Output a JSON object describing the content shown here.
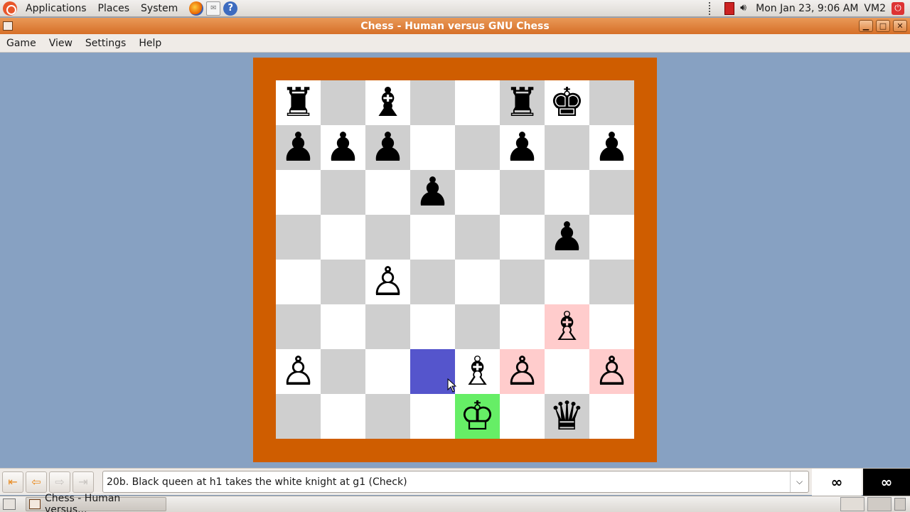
{
  "top_panel": {
    "menus": [
      "Applications",
      "Places",
      "System"
    ],
    "launchers": [
      "firefox-icon",
      "mail-icon",
      "help-icon"
    ],
    "clock": "Mon Jan 23,  9:06 AM",
    "user": "VM2"
  },
  "window": {
    "title": "Chess - Human versus GNU Chess"
  },
  "menubar": {
    "items": [
      "Game",
      "View",
      "Settings",
      "Help"
    ]
  },
  "board": {
    "colors": {
      "frame": "#cf5d00",
      "light_square": "#ffffff",
      "dark_square": "#cfcfcf",
      "last_move_highlight": "#ffcccc",
      "selected_square": "#5555cc",
      "king_in_check": "#66ee66"
    },
    "rows": [
      [
        "bR",
        "",
        "bB",
        "",
        "",
        "bR",
        "bK",
        ""
      ],
      [
        "bP",
        "bP",
        "bP",
        "",
        "",
        "bP",
        "",
        "bP"
      ],
      [
        "",
        "",
        "",
        "bP",
        "",
        "",
        "",
        ""
      ],
      [
        "",
        "",
        "",
        "",
        "",
        "",
        "bP",
        ""
      ],
      [
        "",
        "",
        "wP",
        "",
        "",
        "",
        "",
        ""
      ],
      [
        "",
        "",
        "",
        "",
        "",
        "",
        "wB",
        ""
      ],
      [
        "wP",
        "",
        "",
        "",
        "wB",
        "wP",
        "",
        "wP"
      ],
      [
        "",
        "",
        "",
        "",
        "wK",
        "",
        "bQ",
        ""
      ]
    ],
    "highlights": {
      "5,6": "last_move_highlight",
      "6,5": "last_move_highlight",
      "6,7": "last_move_highlight",
      "6,3": "selected_square",
      "7,4": "king_in_check"
    }
  },
  "toolbar": {
    "nav_buttons": [
      "first-move",
      "previous-move",
      "next-move",
      "last-move"
    ],
    "move_text": "20b. Black queen at h1 takes the white knight at g1 (Check)",
    "white_clock": "∞",
    "black_clock": "∞"
  },
  "taskbar": {
    "task_label": "Chess - Human versus..."
  }
}
